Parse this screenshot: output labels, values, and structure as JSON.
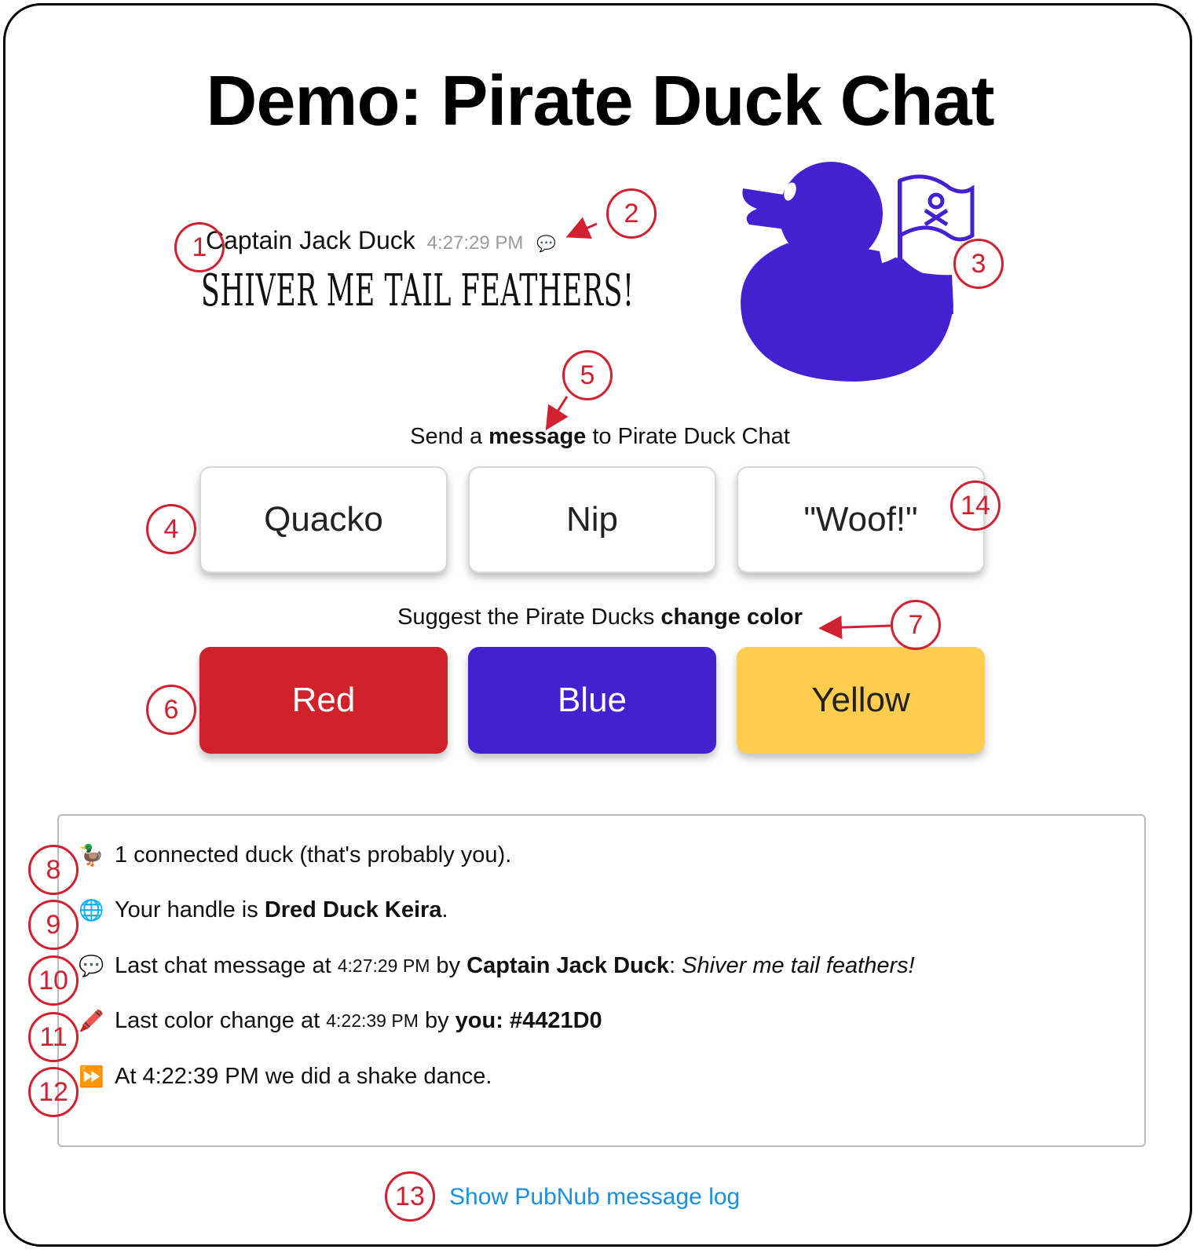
{
  "page": {
    "title": "Demo: Pirate Duck Chat"
  },
  "last_message": {
    "author": "Captain Jack Duck",
    "time": "4:27:29 PM",
    "text": "Shiver me tail feathers!"
  },
  "message_section": {
    "prompt_before": "Send a ",
    "prompt_bold": "message",
    "prompt_after": " to Pirate Duck Chat",
    "buttons": [
      "Quacko",
      "Nip",
      "\"Woof!\""
    ]
  },
  "color_section": {
    "prompt_before": "Suggest the Pirate Ducks ",
    "prompt_bold": "change color",
    "buttons": [
      "Red",
      "Blue",
      "Yellow"
    ],
    "colors": {
      "red": "#d0222a",
      "blue": "#4421D0",
      "yellow": "#fecc4e"
    }
  },
  "status": {
    "connected": {
      "icon": "duck-emoji",
      "text": "1 connected duck (that's probably you)."
    },
    "handle": {
      "icon": "globe-emoji",
      "before": "Your handle is ",
      "name": "Dred Duck Keira",
      "after": "."
    },
    "last_chat": {
      "icon": "speech-bubble-emoji",
      "before": "Last chat message at ",
      "time": "4:27:29 PM",
      "by": " by ",
      "author": "Captain Jack Duck",
      "colon": ": ",
      "text": "Shiver me tail feathers!"
    },
    "last_color": {
      "icon": "crayon-emoji",
      "before": "Last color change at ",
      "time": "4:22:39 PM",
      "by": " by ",
      "who": "you",
      "colon": ": ",
      "value": "#4421D0"
    },
    "dance": {
      "icon": "fast-forward-emoji",
      "text": "At 4:22:39 PM we did a shake dance."
    }
  },
  "footer": {
    "link": "Show PubNub message log"
  },
  "callouts": [
    "1",
    "2",
    "3",
    "4",
    "5",
    "6",
    "7",
    "8",
    "9",
    "10",
    "11",
    "12",
    "13",
    "14"
  ],
  "duck_color": "#4421D0"
}
